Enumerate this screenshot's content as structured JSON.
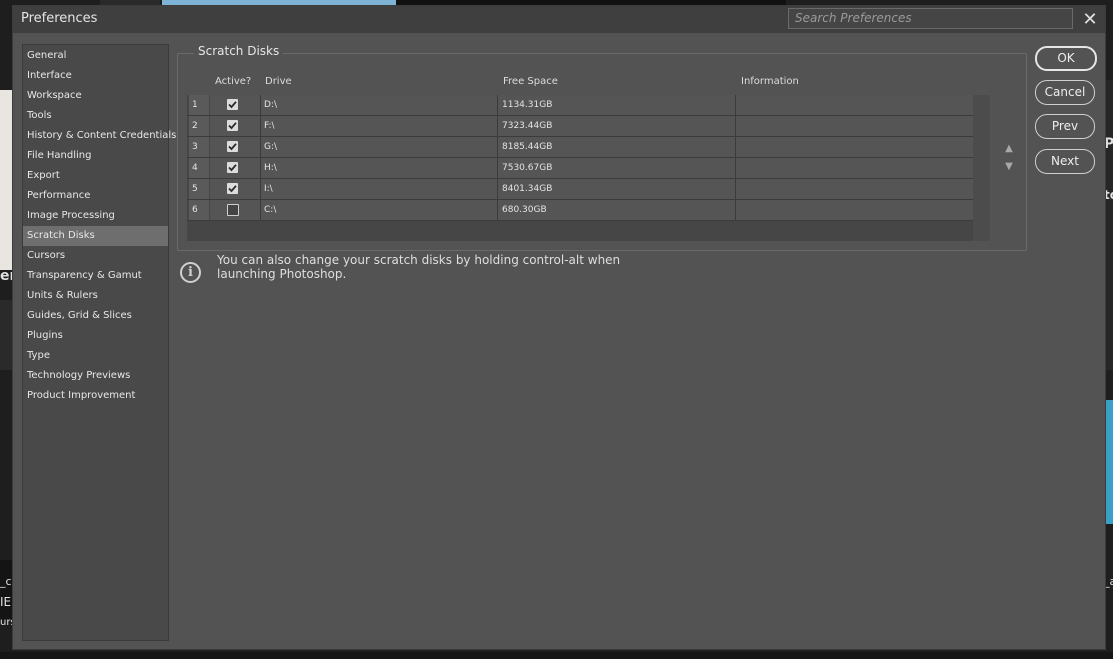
{
  "window": {
    "title": "Preferences",
    "search_placeholder": "Search Preferences",
    "close_glyph": "✕"
  },
  "sidebar": {
    "items": [
      {
        "label": "General",
        "active": false
      },
      {
        "label": "Interface",
        "active": false
      },
      {
        "label": "Workspace",
        "active": false
      },
      {
        "label": "Tools",
        "active": false
      },
      {
        "label": "History & Content Credentials",
        "active": false
      },
      {
        "label": "File Handling",
        "active": false
      },
      {
        "label": "Export",
        "active": false
      },
      {
        "label": "Performance",
        "active": false
      },
      {
        "label": "Image Processing",
        "active": false
      },
      {
        "label": "Scratch Disks",
        "active": true
      },
      {
        "label": "Cursors",
        "active": false
      },
      {
        "label": "Transparency & Gamut",
        "active": false
      },
      {
        "label": "Units & Rulers",
        "active": false
      },
      {
        "label": "Guides, Grid & Slices",
        "active": false
      },
      {
        "label": "Plugins",
        "active": false
      },
      {
        "label": "Type",
        "active": false
      },
      {
        "label": "Technology Previews",
        "active": false
      },
      {
        "label": "Product Improvement",
        "active": false
      }
    ]
  },
  "scratch_disks": {
    "group_label": "Scratch Disks",
    "columns": {
      "active": "Active?",
      "drive": "Drive",
      "free_space": "Free Space",
      "information": "Information"
    },
    "rows": [
      {
        "num": "1",
        "active": true,
        "drive": "D:\\",
        "free_space": "1134.31GB",
        "information": ""
      },
      {
        "num": "2",
        "active": true,
        "drive": "F:\\",
        "free_space": "7323.44GB",
        "information": ""
      },
      {
        "num": "3",
        "active": true,
        "drive": "G:\\",
        "free_space": "8185.44GB",
        "information": ""
      },
      {
        "num": "4",
        "active": true,
        "drive": "H:\\",
        "free_space": "7530.67GB",
        "information": ""
      },
      {
        "num": "5",
        "active": true,
        "drive": "I:\\",
        "free_space": "8401.34GB",
        "information": ""
      },
      {
        "num": "6",
        "active": false,
        "drive": "C:\\",
        "free_space": "680.30GB",
        "information": ""
      }
    ],
    "move_up_glyph": "▲",
    "move_down_glyph": "▼"
  },
  "info": {
    "icon": "info-icon",
    "text": "You can also change your scratch disks by holding control-alt when launching Photoshop."
  },
  "buttons": {
    "ok": "OK",
    "cancel": "Cancel",
    "prev": "Prev",
    "next": "Next"
  },
  "background": {
    "fragments": [
      "er",
      "P",
      "to",
      "_c",
      "IE",
      "urs",
      "_a"
    ]
  },
  "colors": {
    "dialog_bg": "#535353",
    "titlebar_bg": "#3f3f3f",
    "active_nav_bg": "#6e6e6e"
  }
}
